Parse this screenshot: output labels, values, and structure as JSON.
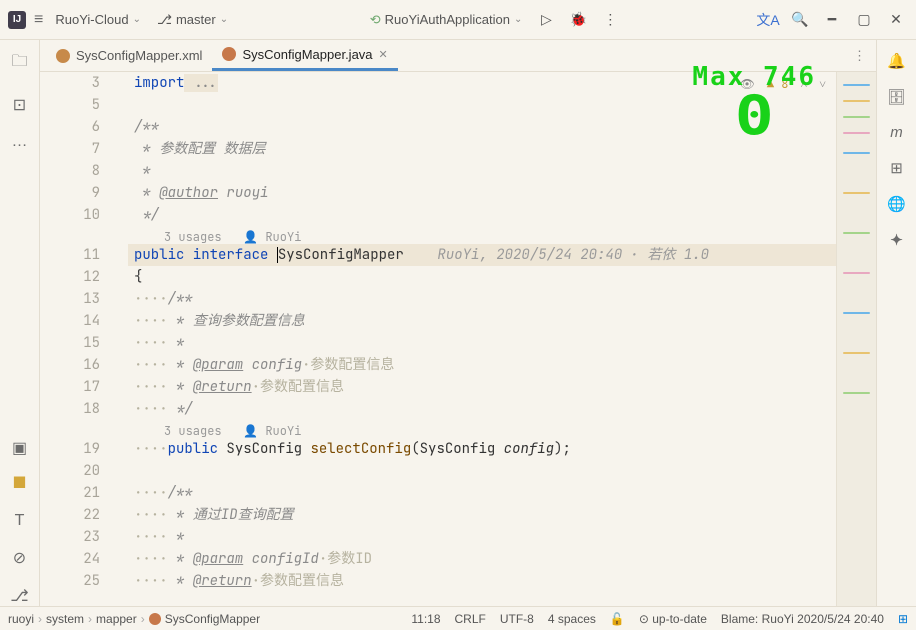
{
  "titlebar": {
    "project": "RuoYi-Cloud",
    "branch": "master",
    "runconfig": "RuoYiAuthApplication"
  },
  "tabs": [
    {
      "label": "SysConfigMapper.xml",
      "active": false
    },
    {
      "label": "SysConfigMapper.java",
      "active": true
    }
  ],
  "editor_info": {
    "warnings": "8"
  },
  "overlay": {
    "title": "Max 746",
    "value": "0"
  },
  "hints": {
    "usages1": "3 usages",
    "author1": "RuoYi",
    "usages2": "3 usages",
    "author2": "RuoYi"
  },
  "inlay": {
    "blame": "RuoYi, 2020/5/24 20:40 · 若依 1.0"
  },
  "lines": {
    "n3": "3",
    "n5": "5",
    "n6": "6",
    "n7": "7",
    "n8": "8",
    "n9": "9",
    "n10": "10",
    "n11": "11",
    "n12": "12",
    "n13": "13",
    "n14": "14",
    "n15": "15",
    "n16": "16",
    "n17": "17",
    "n18": "18",
    "n19": "19",
    "n20": "20",
    "n21": "21",
    "n22": "22",
    "n23": "23",
    "n24": "24",
    "n25": "25"
  },
  "code": {
    "l3_kw": "import",
    "l3_rest": " ...",
    "l6": "/**",
    "l7": " * 参数配置 数据层",
    "l8": " *",
    "l9a": " * ",
    "l9b": "@author",
    "l9c": " ruoyi",
    "l10": " */",
    "l11_public": "public",
    "l11_interface": " interface ",
    "l11_name": "SysConfigMapper",
    "l12": "{",
    "l13_dots": "····",
    "l13": "/**",
    "l14_dots": "···· ",
    "l14": "* 查询参数配置信息",
    "l15_dots": "···· ",
    "l15": "*",
    "l16_dots": "···· ",
    "l16a": "* ",
    "l16b": "@param",
    "l16c": " config",
    "l16d": "·参数配置信息",
    "l17_dots": "···· ",
    "l17a": "* ",
    "l17b": "@return",
    "l17c": "·参数配置信息",
    "l18_dots": "···· ",
    "l18": "*/",
    "l19_dots": "····",
    "l19_public": "public",
    "l19_sp1": " ",
    "l19_type": "SysConfig",
    "l19_sp2": " ",
    "l19_fn": "selectConfig",
    "l19_paren": "(",
    "l19_ptype": "SysConfig",
    "l19_sp3": " ",
    "l19_pname": "config",
    "l19_end": ");",
    "l21_dots": "····",
    "l21": "/**",
    "l22_dots": "···· ",
    "l22": "* 通过ID查询配置",
    "l23_dots": "···· ",
    "l23": "*",
    "l24_dots": "···· ",
    "l24a": "* ",
    "l24b": "@param",
    "l24c": " configId",
    "l24d": "·参数ID",
    "l25_dots": "···· ",
    "l25a": "* ",
    "l25b": "@return",
    "l25c": "·参数配置信息"
  },
  "breadcrumb": {
    "p1": "ruoyi",
    "p2": "system",
    "p3": "mapper",
    "p4": "SysConfigMapper"
  },
  "status": {
    "pos": "11:18",
    "linesep": "CRLF",
    "encoding": "UTF-8",
    "indent": "4 spaces",
    "git": "up-to-date",
    "blame": "Blame: RuoYi 2020/5/24 20:40"
  }
}
